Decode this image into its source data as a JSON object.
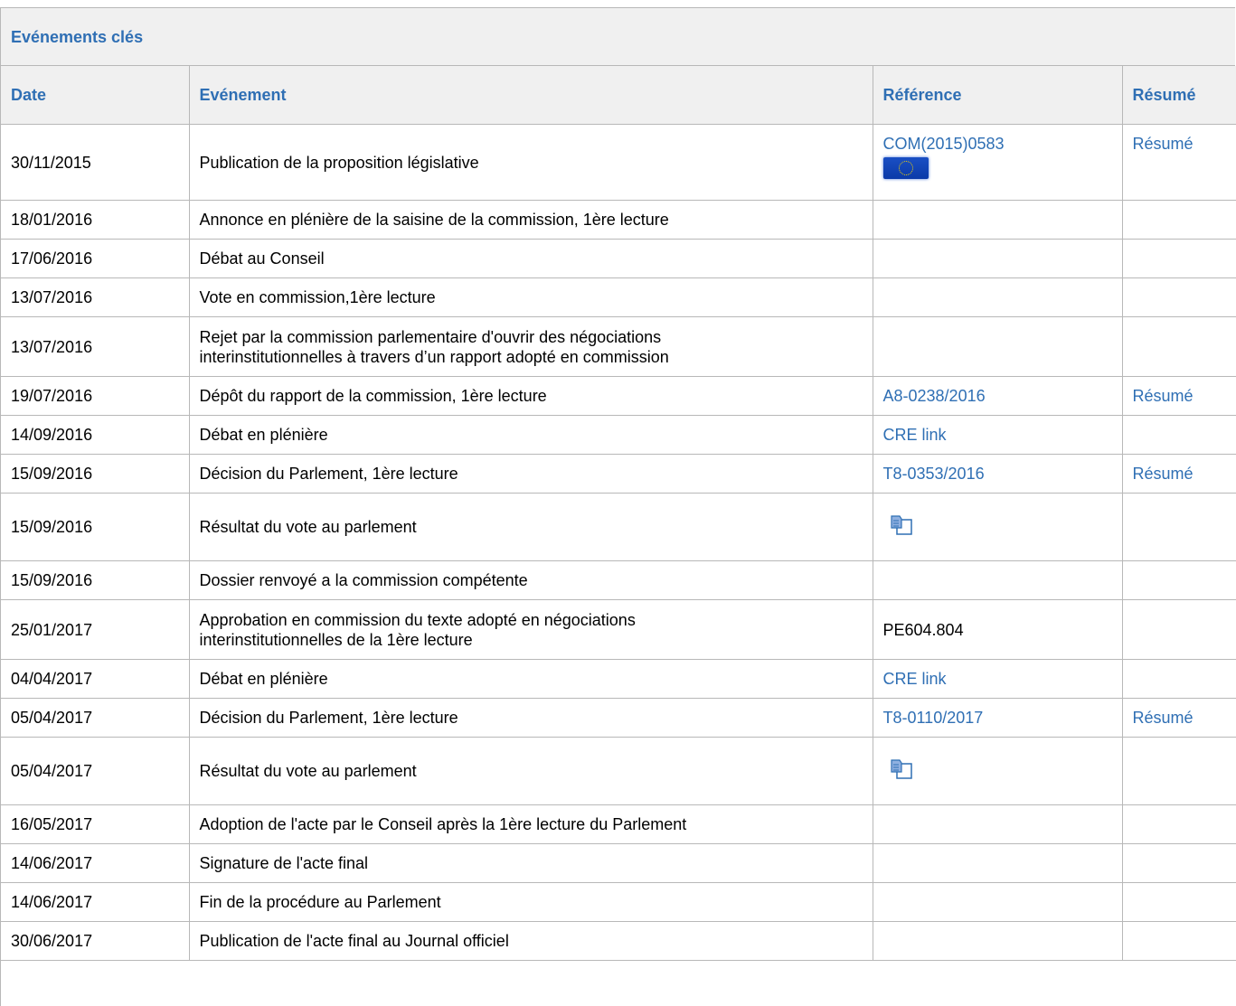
{
  "panel": {
    "title": "Evénements clés"
  },
  "columns": {
    "date": "Date",
    "event": "Evénement",
    "ref": "Référence",
    "summary": "Résumé"
  },
  "rows": [
    {
      "date": "30/11/2015",
      "event": "Publication de la proposition législative",
      "ref": "COM(2015)0583",
      "ref_icon": "eu-flag-icon",
      "summary": "Résumé"
    },
    {
      "date": "18/01/2016",
      "event": "Annonce en plénière de la saisine de la commission, 1ère lecture",
      "ref": "",
      "summary": ""
    },
    {
      "date": "17/06/2016",
      "event": "Débat au Conseil",
      "ref": "",
      "summary": ""
    },
    {
      "date": "13/07/2016",
      "event": "Vote en commission,1ère lecture",
      "ref": "",
      "summary": ""
    },
    {
      "date": "13/07/2016",
      "event": "Rejet par la commission parlementaire d'ouvrir des négociations interinstitutionnelles à travers d’un rapport adopté en commission",
      "ref": "",
      "summary": ""
    },
    {
      "date": "19/07/2016",
      "event": "Dépôt du rapport de la commission, 1ère lecture",
      "ref": "A8-0238/2016",
      "summary": "Résumé"
    },
    {
      "date": "14/09/2016",
      "event": "Débat en plénière",
      "ref": "CRE link",
      "summary": ""
    },
    {
      "date": "15/09/2016",
      "event": "Décision du Parlement, 1ère lecture",
      "ref": "T8-0353/2016",
      "summary": "Résumé"
    },
    {
      "date": "15/09/2016",
      "event": "Résultat du vote au parlement",
      "ref": "",
      "ref_icon": "vote-result-icon",
      "summary": ""
    },
    {
      "date": "15/09/2016",
      "event": "Dossier renvoyé a la commission compétente",
      "ref": "",
      "summary": ""
    },
    {
      "date": "25/01/2017",
      "event": "Approbation en commission du texte adopté en négociations interinstitutionnelles de la 1ère lecture",
      "ref_plain": "PE604.804",
      "summary": ""
    },
    {
      "date": "04/04/2017",
      "event": "Débat en plénière",
      "ref": "CRE link",
      "summary": ""
    },
    {
      "date": "05/04/2017",
      "event": "Décision du Parlement, 1ère lecture",
      "ref": "T8-0110/2017",
      "summary": "Résumé"
    },
    {
      "date": "05/04/2017",
      "event": "Résultat du vote au parlement",
      "ref": "",
      "ref_icon": "vote-result-icon",
      "summary": ""
    },
    {
      "date": "16/05/2017",
      "event": "Adoption de l'acte par le Conseil après la 1ère lecture du Parlement",
      "ref": "",
      "summary": ""
    },
    {
      "date": "14/06/2017",
      "event": "Signature de l'acte final",
      "ref": "",
      "summary": ""
    },
    {
      "date": "14/06/2017",
      "event": "Fin de la procédure au Parlement",
      "ref": "",
      "summary": ""
    },
    {
      "date": "30/06/2017",
      "event": "Publication de l'acte final au Journal officiel",
      "ref": "",
      "summary": ""
    }
  ]
}
